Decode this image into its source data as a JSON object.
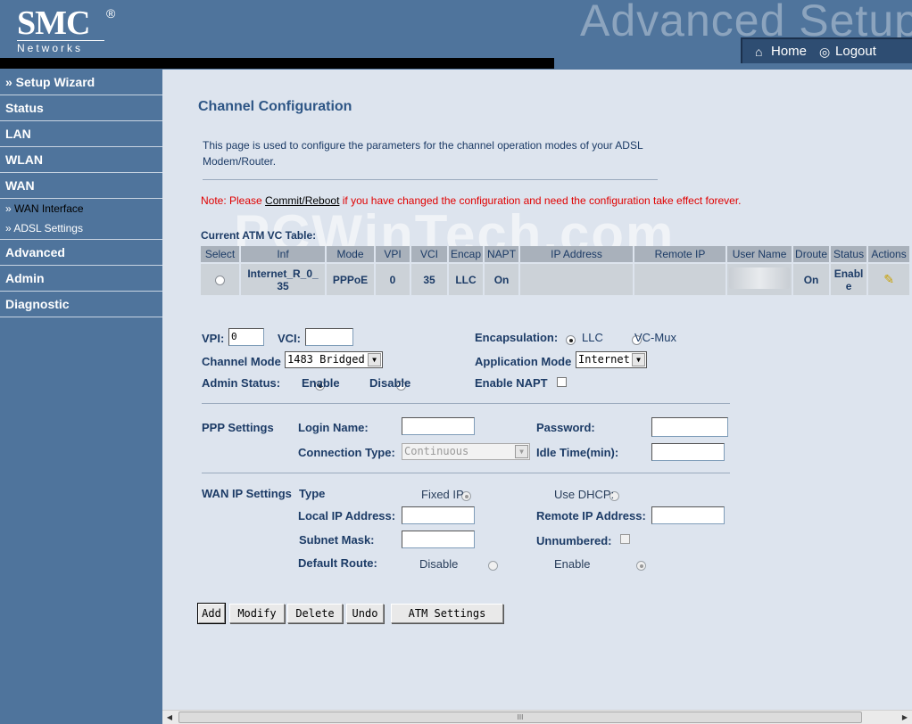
{
  "header": {
    "logo_main": "SMC",
    "logo_reg": "®",
    "logo_sub": "Networks",
    "title": "Advanced Setup",
    "home_label": "Home",
    "logout_label": "Logout"
  },
  "sidebar": {
    "setup_wizard": "» Setup Wizard",
    "status": "Status",
    "lan": "LAN",
    "wlan": "WLAN",
    "wan": "WAN",
    "wan_interface": "WAN Interface",
    "adsl_settings": "ADSL Settings",
    "advanced": "Advanced",
    "admin": "Admin",
    "diagnostic": "Diagnostic",
    "bullet": "»"
  },
  "watermark": "PCWinTech.com",
  "page": {
    "title": "Channel Configuration",
    "desc": "This page is used to configure the parameters for the channel operation modes of your ADSL Modem/Router.",
    "note_prefix": "Note: Please ",
    "note_link": "Commit/Reboot",
    "note_suffix": " if you have changed the configuration and need the configuration take effect forever.",
    "table_title": "Current ATM VC Table:"
  },
  "table": {
    "headers": [
      "Select",
      "Inf",
      "Mode",
      "VPI",
      "VCI",
      "Encap",
      "NAPT",
      "IP Address",
      "Remote IP",
      "User Name",
      "Droute",
      "Status",
      "Actions"
    ],
    "row": {
      "inf_line1": "Internet_R_0_",
      "inf_line2": "35",
      "mode": "PPPoE",
      "vpi": "0",
      "vci": "35",
      "encap": "LLC",
      "napt": "On",
      "droute": "On",
      "status_line1": "Enabl",
      "status_line2": "e"
    }
  },
  "form": {
    "vpi_label": "VPI:",
    "vpi_value": "0",
    "vci_label": "VCI:",
    "vci_value": "",
    "encap_label": "Encapsulation:",
    "encap_llc": "LLC",
    "encap_vcmux": "VC-Mux",
    "channel_mode_label": "Channel Mode",
    "channel_mode_value": "1483 Bridged",
    "app_mode_label": "Application Mode",
    "app_mode_value": "Internet",
    "admin_status_label": "Admin Status:",
    "enable": "Enable",
    "disable": "Disable",
    "enable_napt_label": "Enable NAPT",
    "ppp_settings": "PPP Settings",
    "login_name": "Login Name:",
    "password": "Password:",
    "conn_type": "Connection Type:",
    "conn_type_value": "Continuous",
    "idle_time": "Idle Time(min):",
    "wan_ip_settings": "WAN IP Settings",
    "type_label": "Type",
    "fixed_ip": "Fixed IP",
    "use_dhcp": "Use DHCP:",
    "local_ip": "Local IP Address:",
    "remote_ip": "Remote IP Address:",
    "subnet_mask": "Subnet Mask:",
    "unnumbered": "Unnumbered:",
    "default_route": "Default Route:",
    "dr_disable": "Disable",
    "dr_enable": "Enable"
  },
  "buttons": {
    "add": "Add",
    "modify": "Modify",
    "delete": "Delete",
    "undo": "Undo",
    "atm_settings": "ATM Settings"
  },
  "scrollbar": {
    "left": "◀",
    "right": "▶",
    "grip": "III"
  }
}
